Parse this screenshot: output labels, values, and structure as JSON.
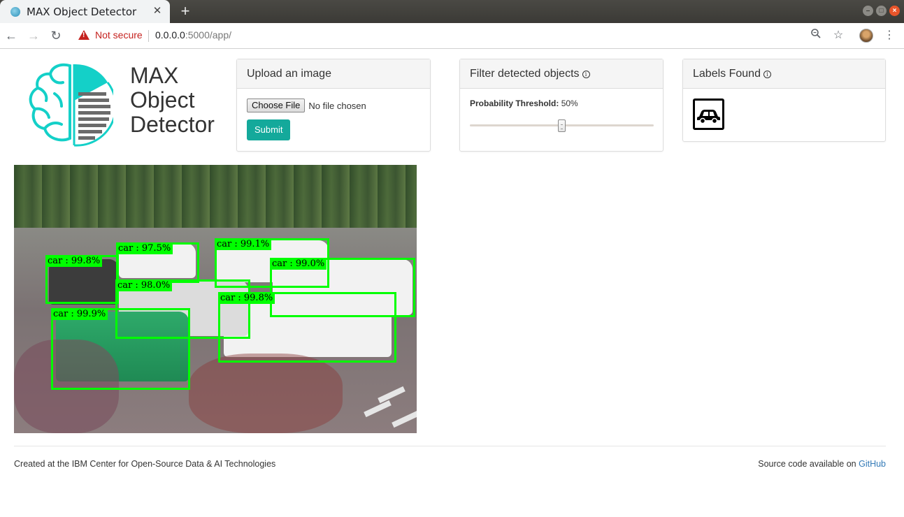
{
  "browser": {
    "tab_title": "MAX Object Detector",
    "tab_close": "✕",
    "new_tab": "+",
    "security_label": "Not secure",
    "url_host": "0.0.0.0",
    "url_rest": ":5000/app/"
  },
  "logo": {
    "line1": "MAX",
    "line2": "Object",
    "line3": "Detector",
    "colors": {
      "teal": "#14d0c8",
      "gray": "#6b6b6b"
    }
  },
  "upload_panel": {
    "title": "Upload an image",
    "choose_file_label": "Choose File",
    "file_status": "No file chosen",
    "submit_label": "Submit"
  },
  "filter_panel": {
    "title": "Filter detected objects",
    "threshold_label": "Probability Threshold:",
    "threshold_value": "50%",
    "threshold_fraction": 0.5
  },
  "labels_panel": {
    "title": "Labels Found",
    "labels": [
      "car-icon"
    ]
  },
  "detections": [
    {
      "label": "car : 99.8%"
    },
    {
      "label": "car : 97.5%"
    },
    {
      "label": "car : 99.1%"
    },
    {
      "label": "car : 99.0%"
    },
    {
      "label": "car : 98.0%"
    },
    {
      "label": "car : 99.8%"
    },
    {
      "label": "car : 99.9%"
    }
  ],
  "colors": {
    "bbox": "#00ff00",
    "submit": "#14a99b",
    "link": "#337ab7",
    "warning": "#c5221f"
  },
  "footer": {
    "left": "Created at the IBM Center for Open-Source Data & AI Technologies",
    "right_prefix": "Source code available on",
    "right_link": "GitHub"
  }
}
